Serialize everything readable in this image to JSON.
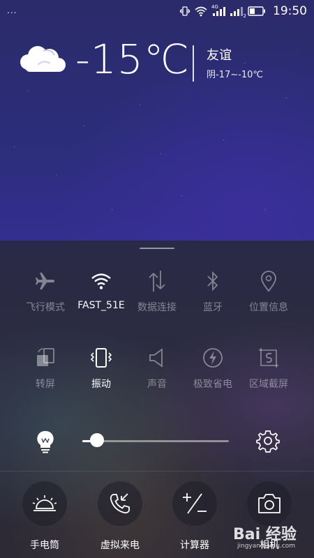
{
  "status_bar": {
    "menu_dots": "...",
    "time": "19:50",
    "signal1_label": "4G",
    "signal2_label": "2",
    "icons": [
      "vibrate-icon",
      "wifi-icon",
      "signal-4g-icon",
      "signal-sim2-icon",
      "battery-icon"
    ]
  },
  "weather": {
    "icon": "cloud-icon",
    "temperature": "-15℃",
    "city": "友谊",
    "condition_range": "阴-17~-10℃"
  },
  "toggles_row1": [
    {
      "label": "飞行模式",
      "icon": "airplane-icon",
      "active": false
    },
    {
      "label": "FAST_51E",
      "icon": "wifi-icon",
      "active": true
    },
    {
      "label": "数据连接",
      "icon": "data-arrows-icon",
      "active": false
    },
    {
      "label": "蓝牙",
      "icon": "bluetooth-icon",
      "active": false
    },
    {
      "label": "位置信息",
      "icon": "location-pin-icon",
      "active": false
    }
  ],
  "toggles_row2": [
    {
      "label": "转屏",
      "icon": "rotate-screen-icon",
      "active": false
    },
    {
      "label": "振动",
      "icon": "vibrate-icon",
      "active": true
    },
    {
      "label": "声音",
      "icon": "speaker-icon",
      "active": false
    },
    {
      "label": "极致省电",
      "icon": "power-saving-icon",
      "active": false
    },
    {
      "label": "区域截屏",
      "icon": "partial-screenshot-icon",
      "active": false
    }
  ],
  "brightness": {
    "icon": "bulb-icon",
    "level": 0.1,
    "settings_icon": "gear-icon"
  },
  "shortcuts": [
    {
      "label": "手电筒",
      "icon": "flashlight-icon"
    },
    {
      "label": "虚拟来电",
      "icon": "fake-call-icon"
    },
    {
      "label": "计算器",
      "icon": "calculator-icon"
    },
    {
      "label": "相机",
      "icon": "camera-icon"
    }
  ],
  "watermark": {
    "text": "Bai 经验",
    "url": "jingyan.baidu.com"
  },
  "colors": {
    "active": "#ffffff",
    "inactive": "rgba(255,255,255,0.42)"
  }
}
